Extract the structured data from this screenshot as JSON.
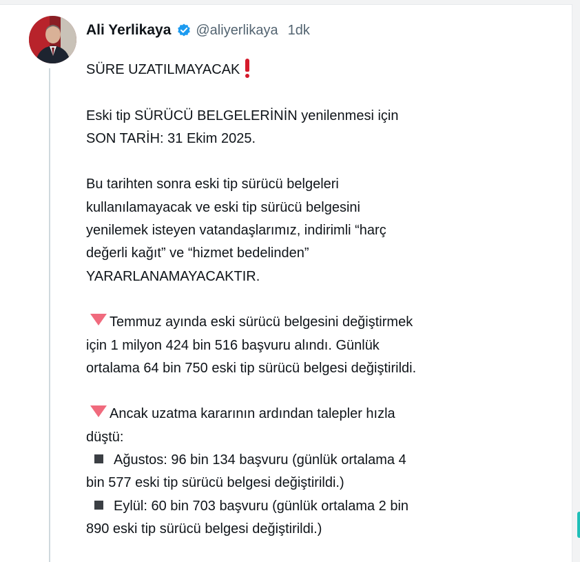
{
  "post": {
    "author_name": "Ali Yerlikaya",
    "handle": "@aliyerlikaya",
    "time": "1dk",
    "lines": {
      "l1": "SÜRE UZATILMAYACAK",
      "l2": "Eski tip SÜRÜCÜ BELGELERİNİN yenilenmesi için",
      "l3": "SON TARİH: 31 Ekim 2025.",
      "l4": "Bu tarihten sonra eski tip sürücü belgeleri",
      "l5": "kullanılamayacak ve eski tip sürücü belgesini",
      "l6": "yenilemek isteyen vatandaşlarımız, indirimli “harç",
      "l7": "değerli kağıt” ve “hizmet bedelinden”",
      "l8": "YARARLANAMAYACAKTIR.",
      "l9": "Temmuz ayında eski sürücü belgesini değiştirmek",
      "l10": "için 1 milyon 424 bin 516 başvuru alındı. Günlük",
      "l11": "ortalama 64 bin 750 eski tip sürücü belgesi değiştirildi.",
      "l12": "Ancak uzatma kararının ardından talepler hızla",
      "l13": "düştü:",
      "l14": "Ağustos: 96 bin 134 başvuru (günlük ortalama 4",
      "l15": "bin 577 eski tip sürücü belgesi değiştirildi.)",
      "l16": "Eylül: 60 bin 703 başvuru (günlük ortalama 2 bin",
      "l17": "890 eski tip sürücü belgesi değiştirildi.)"
    }
  },
  "icons": {
    "verified": "verified-badge-icon",
    "exclamation": "red-exclamation-icon",
    "triangle": "red-down-triangle-icon",
    "bullet": "black-square-icon"
  },
  "colors": {
    "text": "#0f1419",
    "secondary": "#536471",
    "verified": "#1d9bf0",
    "thread_line": "#cfd9de",
    "accent_red": "#d51a2b",
    "triangle": "#f06a7d"
  }
}
